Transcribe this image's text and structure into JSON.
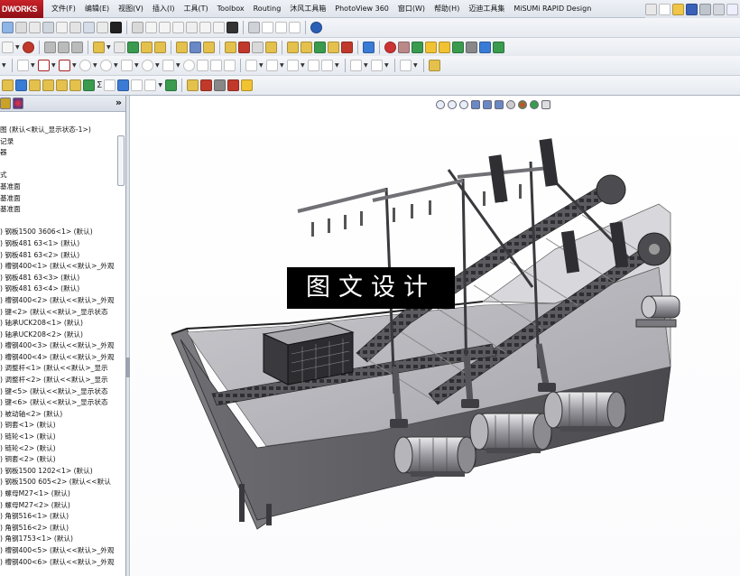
{
  "app": {
    "logo_text": "DWORKS",
    "brand_color": "#b81c24"
  },
  "menubar": {
    "items": [
      "文件(F)",
      "编辑(E)",
      "视图(V)",
      "插入(I)",
      "工具(T)",
      "Toolbox",
      "Routing",
      "沐风工具箱",
      "PhotoView 360",
      "窗口(W)",
      "帮助(H)",
      "迈迪工具集",
      "MiSUMi RAPID Design"
    ]
  },
  "feature_tree": {
    "items": [
      "图  (默认<默认_显示状态-1>)",
      "记录",
      "器",
      "",
      "式",
      "基准面",
      "基准面",
      "基准面",
      "",
      ") 钢板1500 3606<1> (默认)",
      ") 钢板481 63<1> (默认)",
      ") 钢板481 63<2> (默认)",
      ") 槽钢400<1> (默认<<默认>_外观",
      ") 钢板481 63<3> (默认)",
      ") 钢板481 63<4> (默认)",
      ") 槽钢400<2> (默认<<默认>_外观",
      ") 键<2> (默认<<默认>_显示状态",
      ") 轴承UCK208<1> (默认)",
      ") 轴承UCK208<2> (默认)",
      ") 槽钢400<3> (默认<<默认>_外观",
      ") 槽钢400<4> (默认<<默认>_外观",
      ") 调整杆<1> (默认<<默认>_显示",
      ") 调整杆<2> (默认<<默认>_显示",
      ") 键<5> (默认<<默认>_显示状态",
      ") 键<6> (默认<<默认>_显示状态",
      ") 被动轴<2> (默认)",
      ") 铜套<1> (默认)",
      ") 链轮<1> (默认)",
      ") 链轮<2> (默认)",
      ") 铜套<2> (默认)",
      ") 钢板1500 1202<1> (默认)",
      ") 钢板1500 605<2> (默认<<默认",
      ") 螺母M27<1> (默认)",
      ") 螺母M27<2> (默认)",
      ") 角钢516<1> (默认)",
      ") 角钢516<2> (默认)",
      ") 角钢1753<1> (默认)",
      ") 槽钢400<5> (默认<<默认>_外观",
      ") 槽钢400<6> (默认<<默认>_外观"
    ]
  },
  "panel": {
    "collapse_label": "»"
  },
  "toolbar": {
    "sum_label": "Σ"
  },
  "watermark": {
    "text": "图文设计"
  },
  "colors": {
    "model_dark": "#4a4a4e",
    "model_mid": "#8d8d92",
    "model_light": "#c9c9ce",
    "panel_accent": "#c9a227"
  }
}
